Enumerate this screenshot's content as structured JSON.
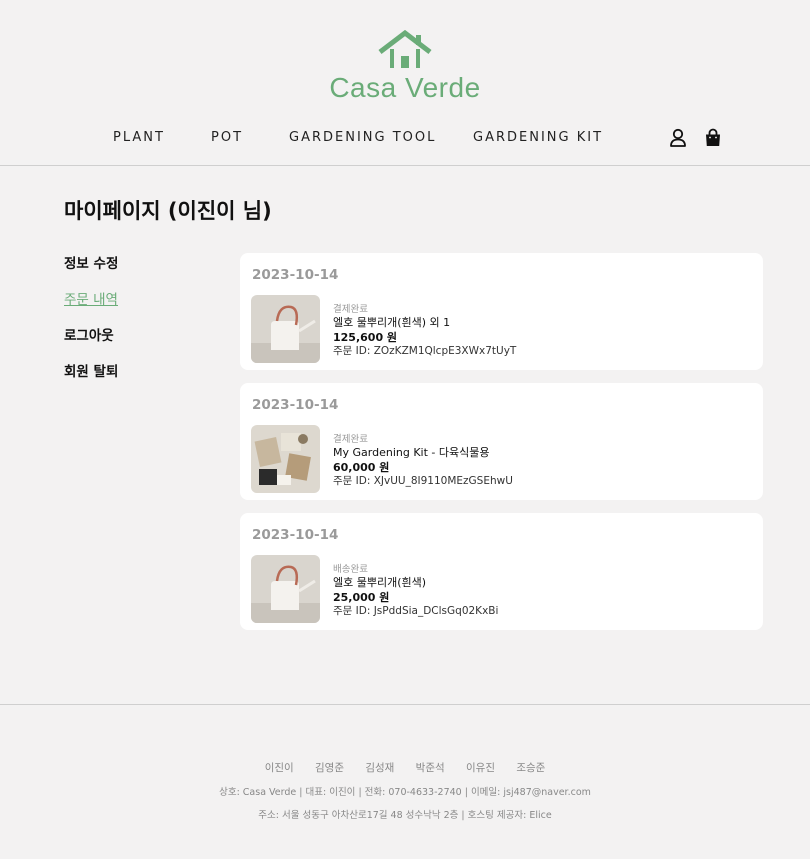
{
  "brand": {
    "name": "Casa Verde",
    "accent": "#6aac78"
  },
  "nav": {
    "items": [
      "PLANT",
      "POT",
      "GARDENING TOOL",
      "GARDENING KIT"
    ]
  },
  "icons": {
    "user": "user-icon",
    "bag": "shopping-bag-icon"
  },
  "page_title": "마이페이지 (이진이 님)",
  "sidebar": {
    "items": [
      "정보 수정",
      "주문 내역",
      "로그아웃",
      "회원 탈퇴"
    ],
    "active": "주문 내역"
  },
  "orders": [
    {
      "date": "2023-10-14",
      "status": "결제완료",
      "product": "엘호 물뿌리개(흰색) 외 1",
      "price": "125,600 원",
      "order_id": "주문 ID: ZOzKZM1QlcpE3XWx7tUyT"
    },
    {
      "date": "2023-10-14",
      "status": "결제완료",
      "product": "My Gardening Kit - 다육식물용",
      "price": "60,000 원",
      "order_id": "주문 ID: XJvUU_8I9110MEzGSEhwU"
    },
    {
      "date": "2023-10-14",
      "status": "배송완료",
      "product": "엘호 물뿌리개(흰색)",
      "price": "25,000 원",
      "order_id": "주문 ID: JsPddSia_DClsGq02KxBi"
    }
  ],
  "footer": {
    "members": [
      "이진이",
      "김영준",
      "김성재",
      "박준석",
      "이유진",
      "조승준"
    ],
    "company": "상호: Casa Verde | 대표: 이진이 | 전화: 070-4633-2740 | 이메일: jsj487@naver.com",
    "address": "주소: 서울 성동구 아차산로17길 48 성수낙낙 2층 | 호스팅 제공자: Elice"
  }
}
